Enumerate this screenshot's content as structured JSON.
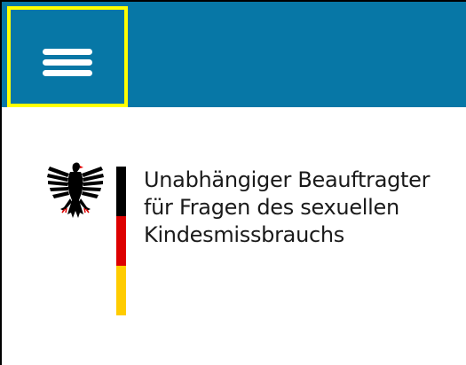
{
  "header": {
    "menu_button_icon": "hamburger-menu-icon",
    "background_color": "#0777a6",
    "focus_outline_color": "#ffff00"
  },
  "logo": {
    "emblem_icon": "federal-eagle-icon",
    "flag_colors": [
      "#000000",
      "#dd0000",
      "#ffcc00"
    ],
    "org_name_lines": [
      "Unabhängiger Beauftragter",
      "für Fragen des sexuellen",
      "Kindesmissbrauchs"
    ]
  }
}
